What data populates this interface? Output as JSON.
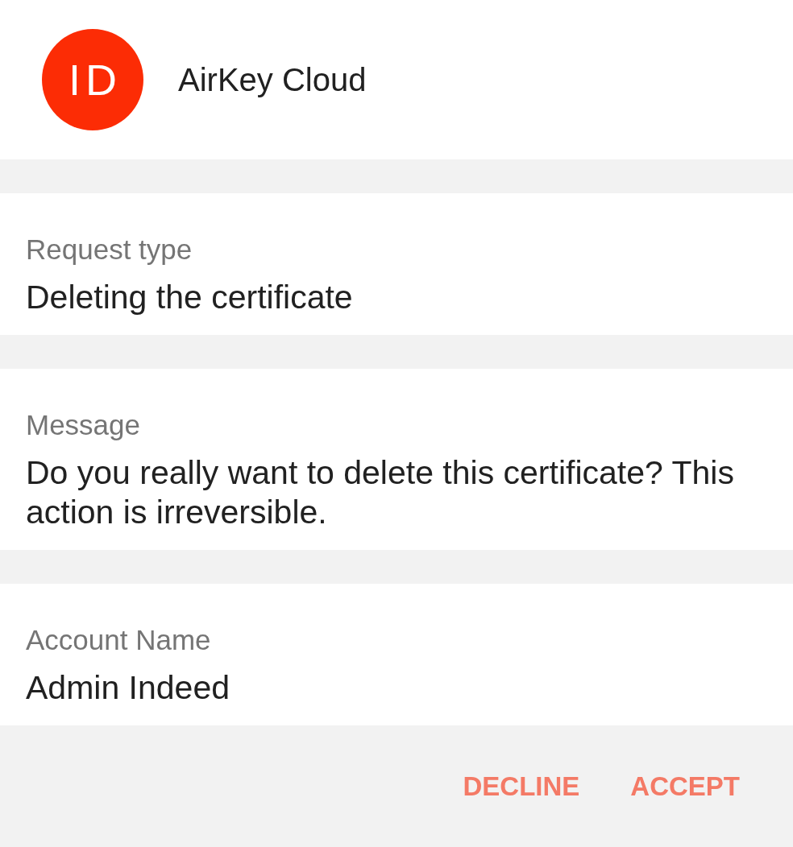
{
  "header": {
    "logo": "ID",
    "title": "AirKey Cloud"
  },
  "fields": [
    {
      "label": "Request type",
      "value": "Deleting the certificate"
    },
    {
      "label": "Message",
      "value": "Do you really want to delete this certificate? This action is irreversible."
    },
    {
      "label": "Account Name",
      "value": "Admin Indeed"
    }
  ],
  "buttons": [
    "DECLINE",
    "ACCEPT"
  ]
}
